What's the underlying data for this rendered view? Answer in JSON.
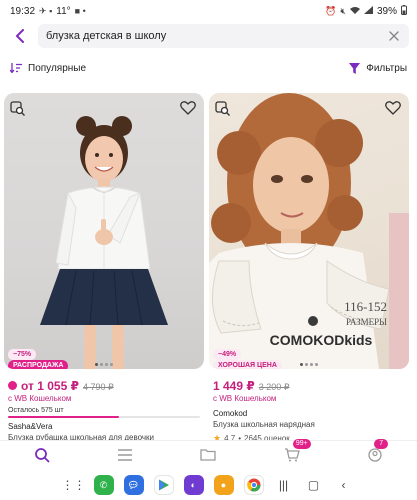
{
  "status_bar": {
    "time": "19:32",
    "weather": "11°",
    "battery": "39%"
  },
  "search": {
    "query": "блузка детская в школу",
    "placeholder": ""
  },
  "controls": {
    "sort_label": "Популярные",
    "filter_label": "Фильтры"
  },
  "products": [
    {
      "discount": "−75%",
      "promo": "РАСПРОДАЖА",
      "price": "от 1 055 ₽",
      "old_price": "4 790 ₽",
      "wallet": "с WB Кошельком",
      "stock": "Осталось 575 шт",
      "stock_fraction": 0.58,
      "brand": "Sasha&Vera",
      "name": "Блузка рубашка школьная для девочки"
    },
    {
      "discount": "−49%",
      "promo": "ХОРОШАЯ ЦЕНА",
      "price": "1 449 ₽",
      "old_price": "3 200 ₽",
      "wallet": "с WB Кошельком",
      "brand": "Comokod",
      "name": "Блузка школьная нарядная",
      "rating": "4,7",
      "reviews": "2645 оценок",
      "photo_text_sizes": "116-152",
      "photo_text_sizes_label": "РАЗМЕРЫ",
      "photo_text_brand": "COMOKODkids"
    }
  ],
  "bottom_nav": {
    "cart_badge": "99+",
    "profile_badge": "7"
  },
  "colors": {
    "accent": "#c41f7c",
    "sale": "#e0218a",
    "filter_icon": "#7b2cbf"
  }
}
